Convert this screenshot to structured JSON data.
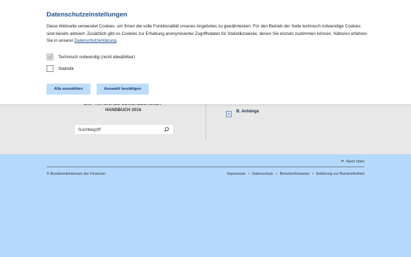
{
  "cookie_banner": {
    "title": "Datenschutzeinstellungen",
    "text": "Diese Webseite verwendet Cookies, um Ihnen die volle Funktionalität unseres Angebotes zu gewährleisten. Für den Betrieb der Seite technisch notwendige Cookies sind bereits aktiviert. Zusätzlich gibt es Cookies zur Erhebung anonymisierter Zugriffsdaten für Statistikzwecke, denen Sie einzeln zustimmen können. Näheres erfahren Sie in unserer ",
    "privacy_link": "Datenschutzerklärung",
    "text_end": ".",
    "options": [
      {
        "label": "Technisch notwendig (nicht abwählbar)",
        "checked": true,
        "disabled": true
      },
      {
        "label": "Statistik",
        "checked": false,
        "disabled": false
      }
    ],
    "btn_select_all": "Alle auswählen",
    "btn_confirm": "Auswahl bestätigen"
  },
  "content": {
    "handbook_title_line1": "BMF-AMTLICHES GEWERBESTEUER-",
    "handbook_title_line2": "HANDBUCH 2016",
    "search_placeholder": "Suchbegriff",
    "search_icon": "magnifier-icon",
    "anhang_icon": "document-icon",
    "anhang_label": "B. Anhänge"
  },
  "footer": {
    "back_to_top": "Nach oben",
    "copyright": "© Bundesministerium der Finanzen",
    "links": [
      "Impressum",
      "Datenschutz",
      "Benutzerhinweise",
      "Erklärung zur Barrierefreiheit"
    ]
  },
  "colors": {
    "accent": "#1d4f91",
    "button_bg": "#bcdcf8",
    "footer_bg": "#b5d9fd",
    "content_bg": "#e8e8e8"
  }
}
